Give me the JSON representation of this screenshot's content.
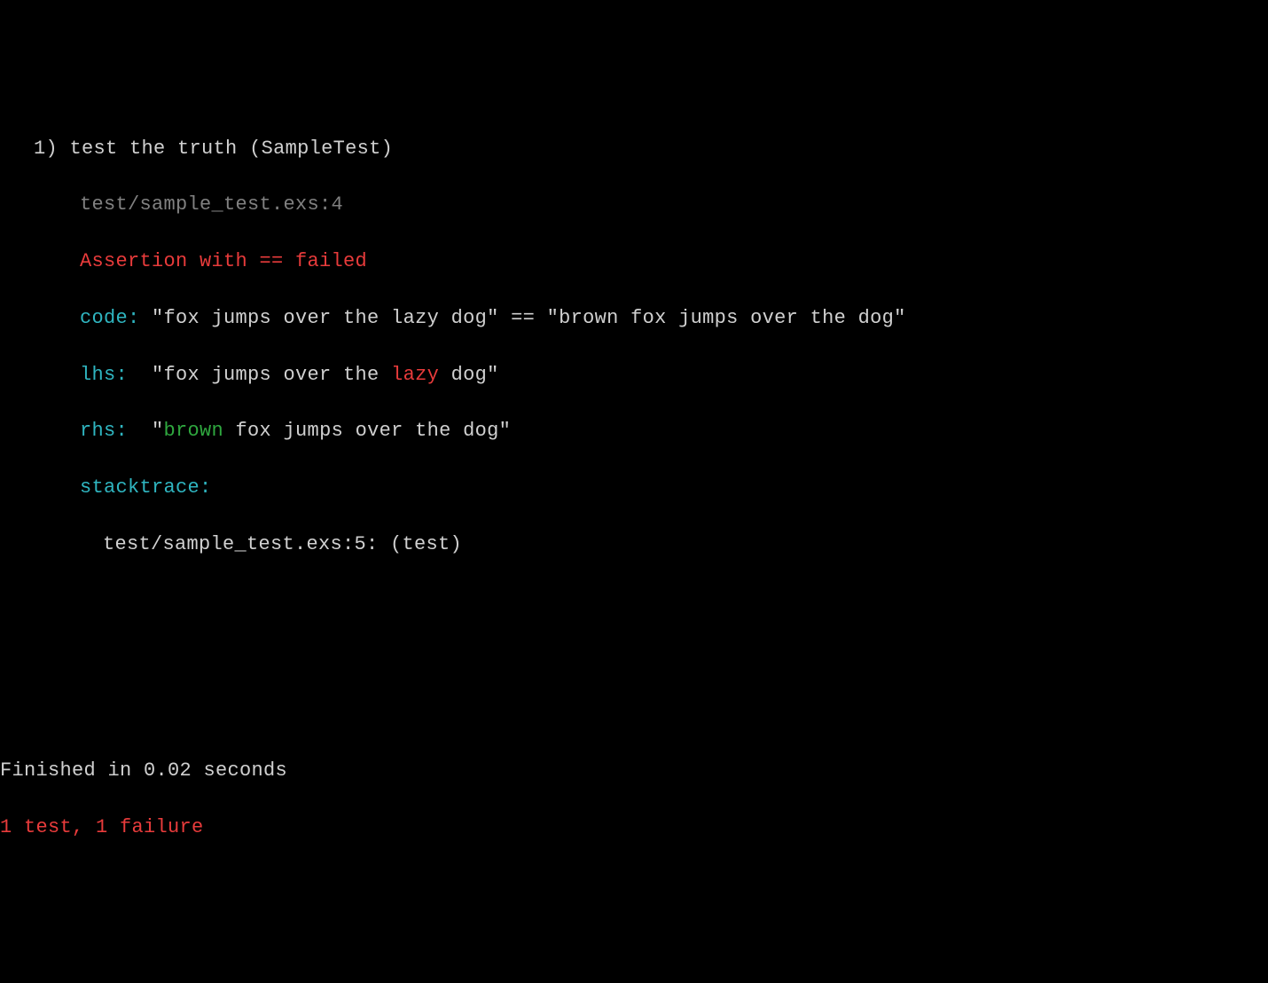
{
  "test_number": "1)",
  "test_title": "test the truth (SampleTest)",
  "file_location": "test/sample_test.exs:4",
  "assertion_error": "Assertion with == failed",
  "code_label": "code:",
  "code_expr": " \"fox jumps over the lazy dog\" == \"brown fox jumps over the dog\"",
  "lhs_label": "lhs: ",
  "lhs_prefix": " \"fox jumps over the ",
  "lhs_diff": "lazy",
  "lhs_suffix": " dog\"",
  "rhs_label": "rhs: ",
  "rhs_prefix": " \"",
  "rhs_diff": "brown",
  "rhs_suffix": " fox jumps over the dog\"",
  "stacktrace_label": "stacktrace:",
  "stacktrace_line": "test/sample_test.exs:5: (test)",
  "finished_line": "Finished in 0.02 seconds",
  "summary_line": "1 test, 1 failure"
}
